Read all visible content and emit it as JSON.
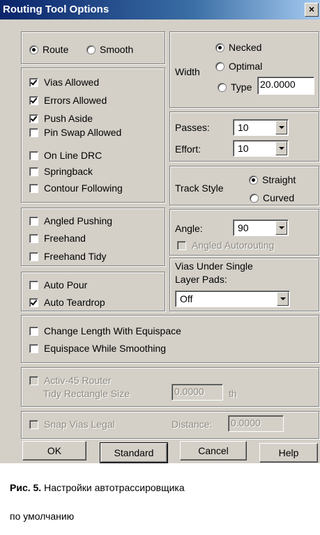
{
  "window": {
    "title": "Routing Tool Options",
    "close": "×"
  },
  "mode": {
    "route": "Route",
    "smooth": "Smooth",
    "selected": "Route"
  },
  "options": {
    "vias_allowed": "Vias Allowed",
    "errors_allowed": "Errors Allowed",
    "push_aside": "Push Aside",
    "pin_swap_allowed": "Pin Swap Allowed",
    "on_line_drc": "On Line DRC",
    "springback": "Springback",
    "contour_following": "Contour Following",
    "checked": [
      "Vias Allowed",
      "Errors Allowed",
      "Push Aside"
    ]
  },
  "width": {
    "label": "Width",
    "necked": "Necked",
    "optimal": "Optimal",
    "type": "Type",
    "type_value": "20.0000",
    "selected": "Necked"
  },
  "passes": {
    "label": "Passes:",
    "value": "10"
  },
  "effort": {
    "label": "Effort:",
    "value": "10"
  },
  "track_style": {
    "label": "Track Style",
    "straight": "Straight",
    "curved": "Curved",
    "selected": "Straight"
  },
  "pushing": {
    "angled_pushing": "Angled Pushing",
    "freehand": "Freehand",
    "freehand_tidy": "Freehand Tidy"
  },
  "angle": {
    "label": "Angle:",
    "value": "90",
    "angled_autorouting": "Angled Autorouting"
  },
  "vias_under": {
    "label_line1": "Vias Under Single",
    "label_line2": "Layer Pads:",
    "value": "Off"
  },
  "pour": {
    "auto_pour": "Auto Pour",
    "auto_teardrop": "Auto Teardrop"
  },
  "equispace": {
    "change_length": "Change Length With Equispace",
    "while_smoothing": "Equispace While Smoothing"
  },
  "activ45": {
    "router": "Activ-45 Router",
    "tidy_label": "Tidy Rectangle Size",
    "tidy_value": "0.0000",
    "unit": "th"
  },
  "snap": {
    "snap_vias": "Snap Vias Legal",
    "distance_label": "Distance:",
    "distance_value": "0.0000"
  },
  "buttons": {
    "ok": "OK",
    "standard": "Standard",
    "cancel": "Cancel",
    "help": "Help"
  },
  "caption": {
    "fig": "Рис. 5.",
    "line1": "Настройки автотрассировщика",
    "line2": "по умолчанию"
  }
}
